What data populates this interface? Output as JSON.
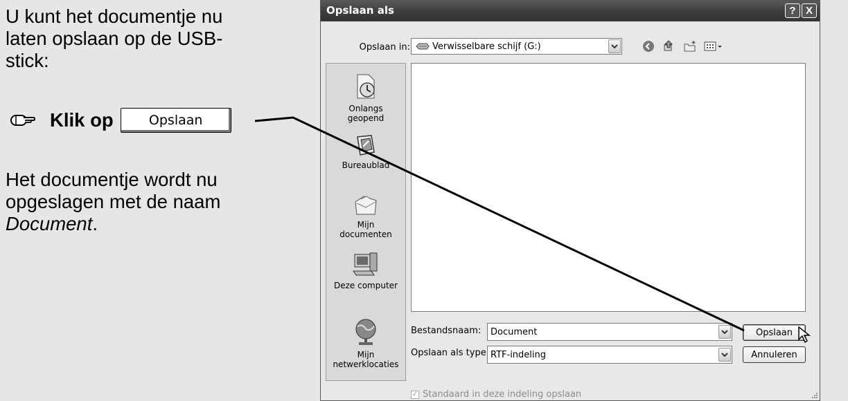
{
  "instructions": {
    "line1": "U kunt het documentje nu",
    "line2": "laten opslaan op de USB-",
    "line3": "stick:",
    "step_label": "Klik op",
    "step_button": "Opslaan",
    "para_line1": "Het documentje wordt nu",
    "para_line2": "opgeslagen met de naam",
    "para_doc_name": "Document",
    "para_end": "."
  },
  "dialog": {
    "title": "Opslaan als",
    "help_button": "?",
    "close_button": "X",
    "lookin_label": "Opslaan in:",
    "lookin_value": "Verwisselbare schijf (G:)",
    "toolbar_icons": [
      "back-icon",
      "up-folder-icon",
      "new-folder-icon",
      "view-menu-icon"
    ],
    "places": [
      {
        "line1": "Onlangs",
        "line2": "geopend",
        "icon": "recent-icon"
      },
      {
        "line1": "Bureaublad",
        "line2": "",
        "icon": "desktop-icon"
      },
      {
        "line1": "Mijn",
        "line2": "documenten",
        "icon": "my-documents-icon"
      },
      {
        "line1": "Deze computer",
        "line2": "",
        "icon": "computer-icon"
      },
      {
        "line1": "Mijn",
        "line2": "netwerklocaties",
        "icon": "network-icon"
      }
    ],
    "filename_label": "Bestandsnaam:",
    "filename_value": "Document",
    "filetype_label": "Opslaan als type:",
    "filetype_value": "RTF-indeling",
    "save_button": "Opslaan",
    "cancel_button": "Annuleren",
    "default_checkbox": "Standaard in deze indeling opslaan"
  }
}
